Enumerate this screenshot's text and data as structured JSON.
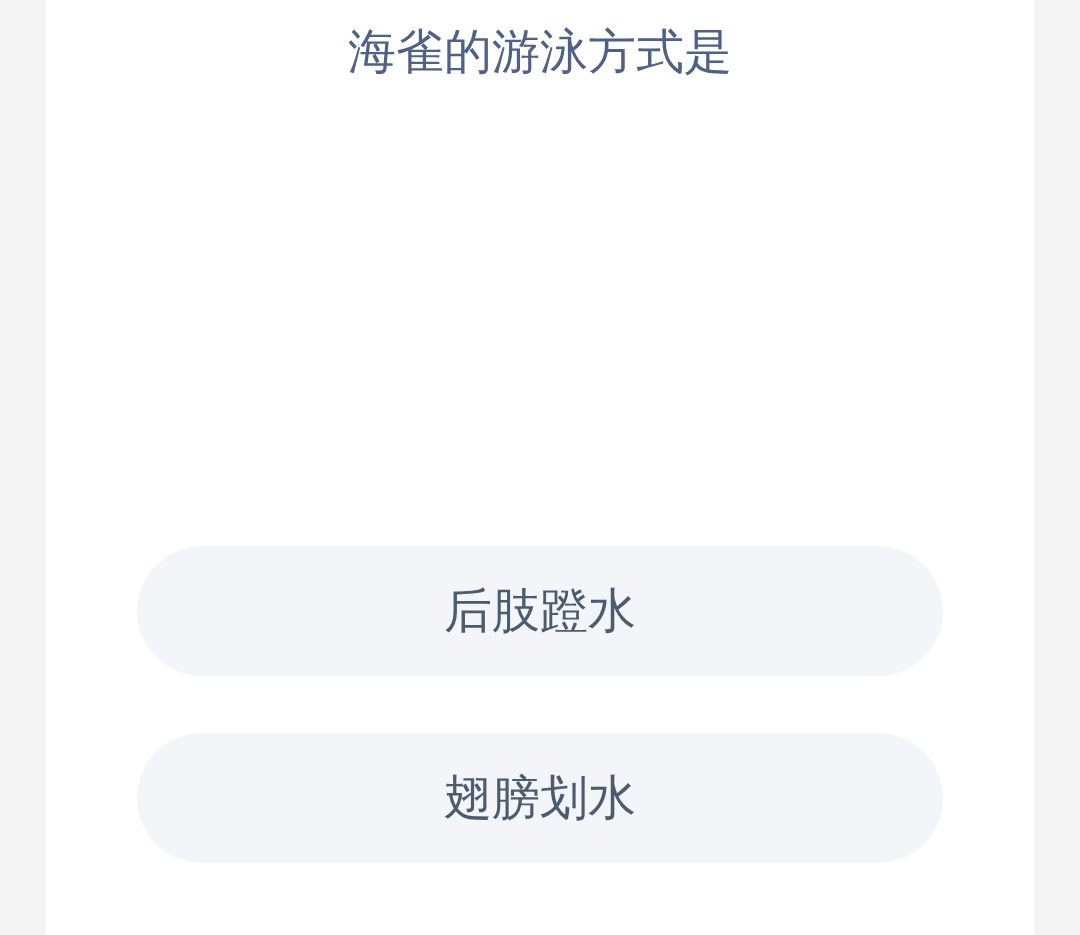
{
  "question": "海雀的游泳方式是",
  "options": [
    {
      "label": "后肢蹬水"
    },
    {
      "label": "翅膀划水"
    }
  ]
}
